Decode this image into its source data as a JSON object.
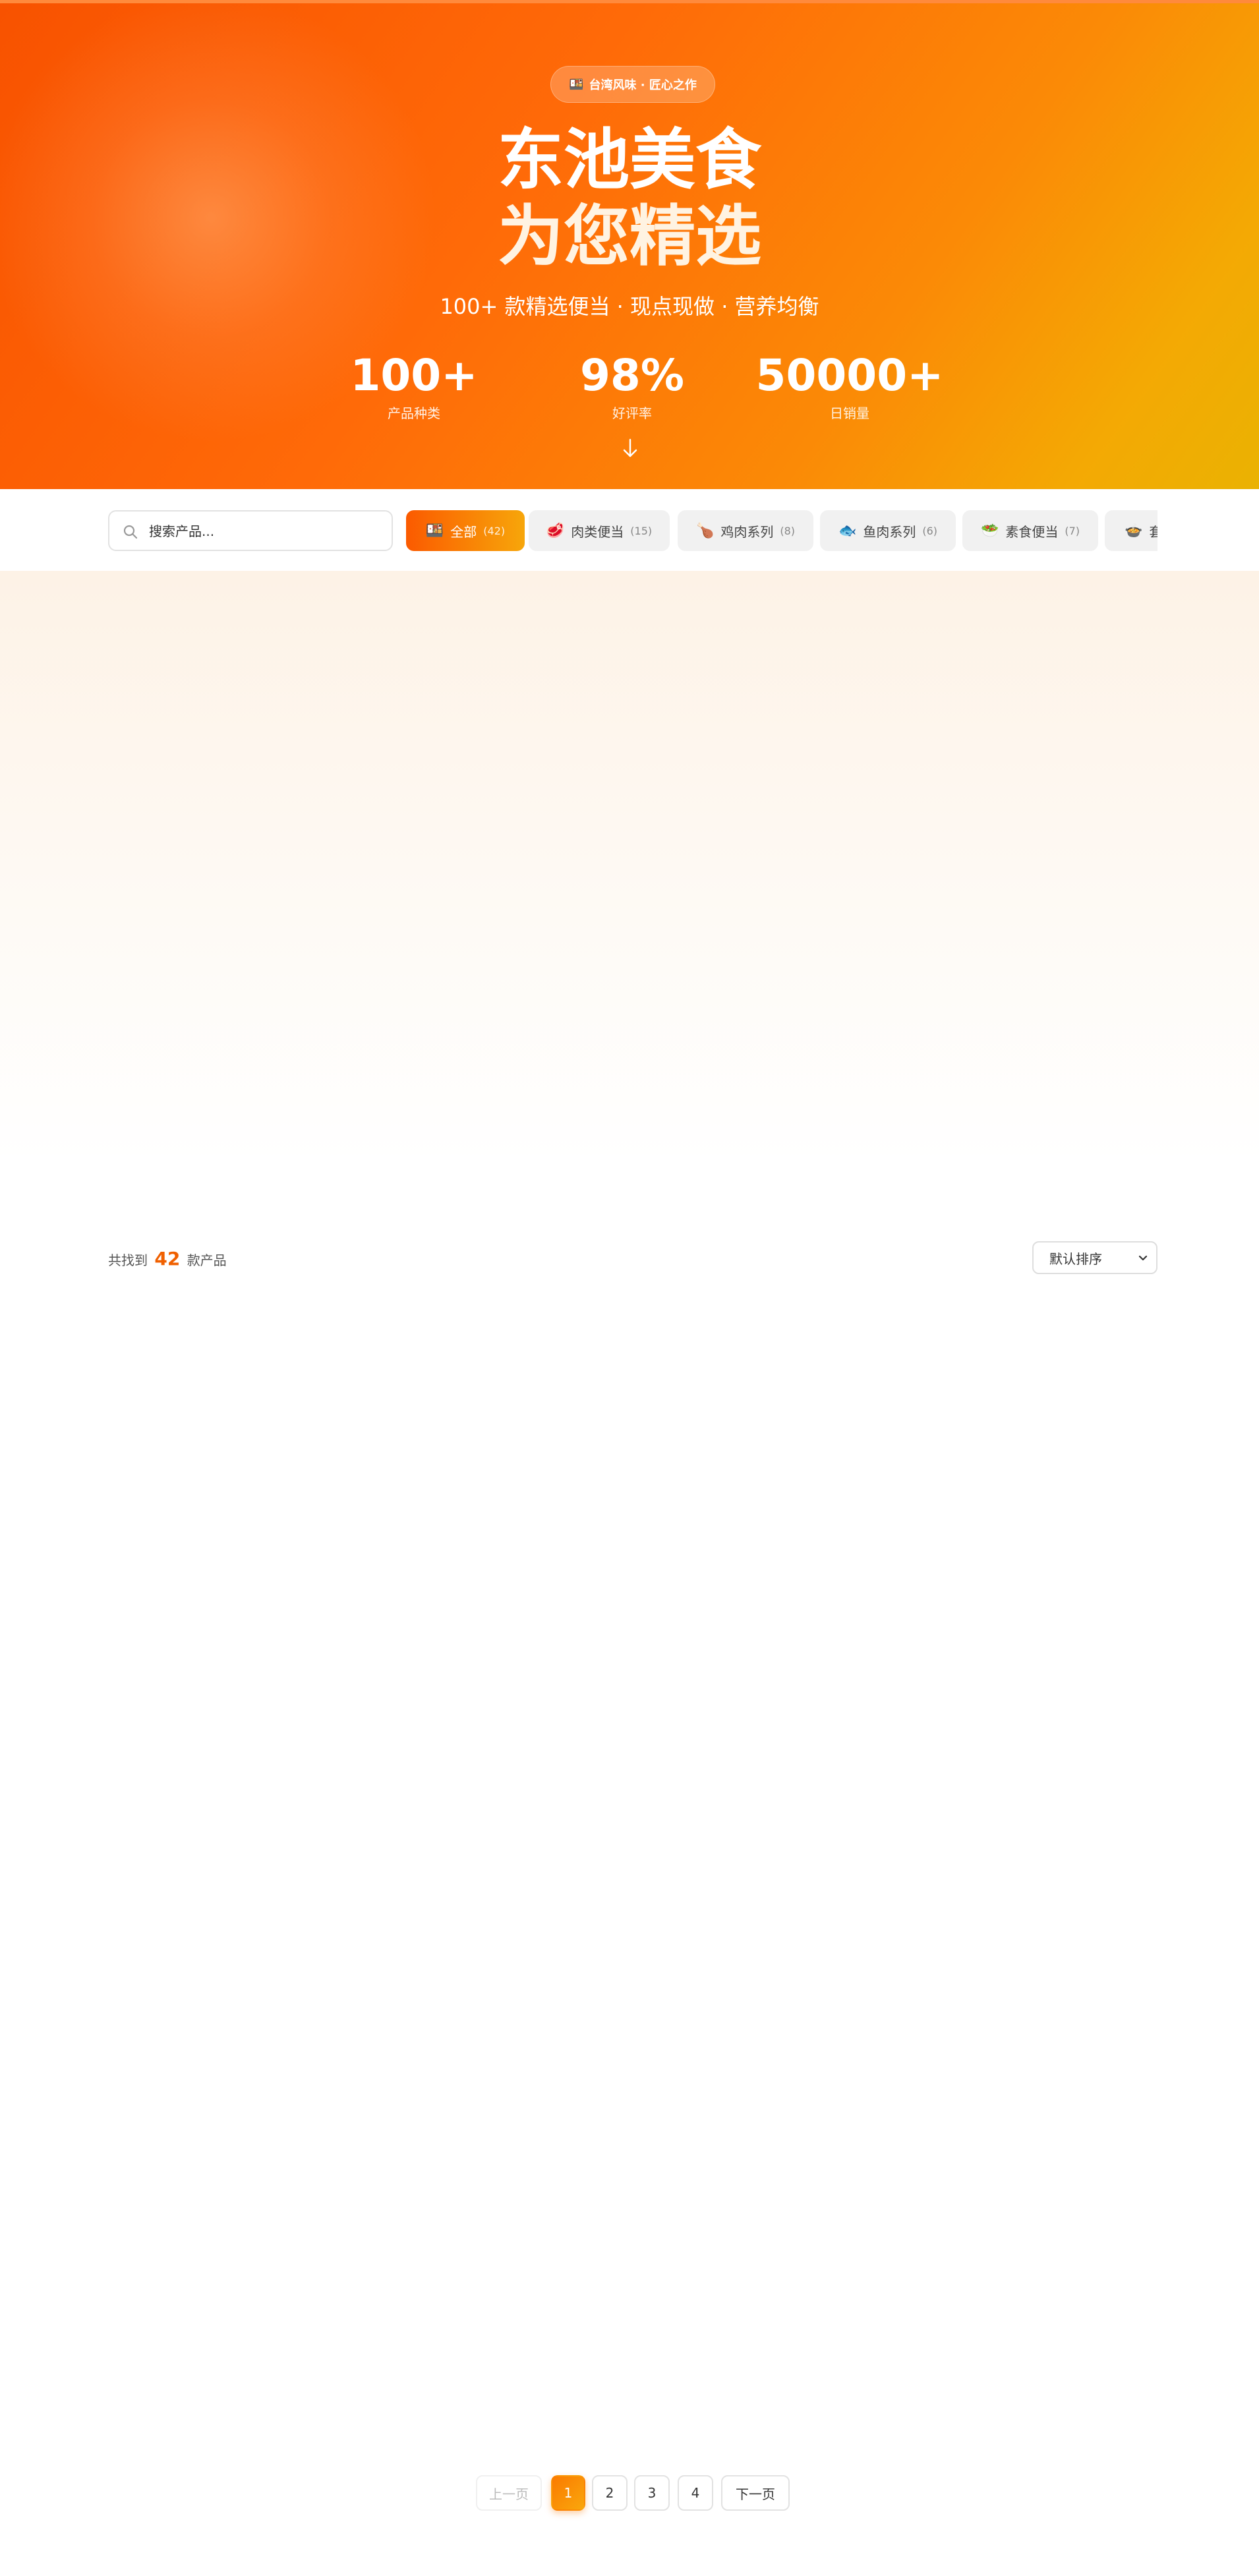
{
  "hero": {
    "badge_icon": "🍱",
    "badge_text": "台湾风味 · 匠心之作",
    "title_line1": "东池美食",
    "title_line2": "为您精选",
    "subtitle": "100+ 款精选便当 · 现点现做 · 营养均衡",
    "stats": [
      {
        "value": "100+",
        "label": "产品种类"
      },
      {
        "value": "98%",
        "label": "好评率"
      },
      {
        "value": "50000+",
        "label": "日销量"
      }
    ],
    "scroll_icon": "arrow-down-icon"
  },
  "filter": {
    "search_placeholder": "搜索产品...",
    "categories": [
      {
        "icon": "🍱",
        "label": "全部",
        "count": "(42)"
      },
      {
        "icon": "🥩",
        "label": "肉类便当",
        "count": "(15)"
      },
      {
        "icon": "🍗",
        "label": "鸡肉系列",
        "count": "(8)"
      },
      {
        "icon": "🐟",
        "label": "鱼肉系列",
        "count": "(6)"
      },
      {
        "icon": "🥗",
        "label": "素食便当",
        "count": "(7)"
      },
      {
        "icon": "🍲",
        "label": "套",
        "count": ""
      }
    ]
  },
  "results": {
    "prefix": "共找到",
    "count": "42",
    "suffix": "款产品",
    "sort_selected": "默认排序"
  },
  "pagination": {
    "prev": "上一页",
    "pages": [
      "1",
      "2",
      "3",
      "4"
    ],
    "current": "1",
    "next": "下一页"
  },
  "colors": {
    "accent": "#ff6a08",
    "accent_light": "#f7a60a",
    "count_highlight": "#f06000"
  }
}
